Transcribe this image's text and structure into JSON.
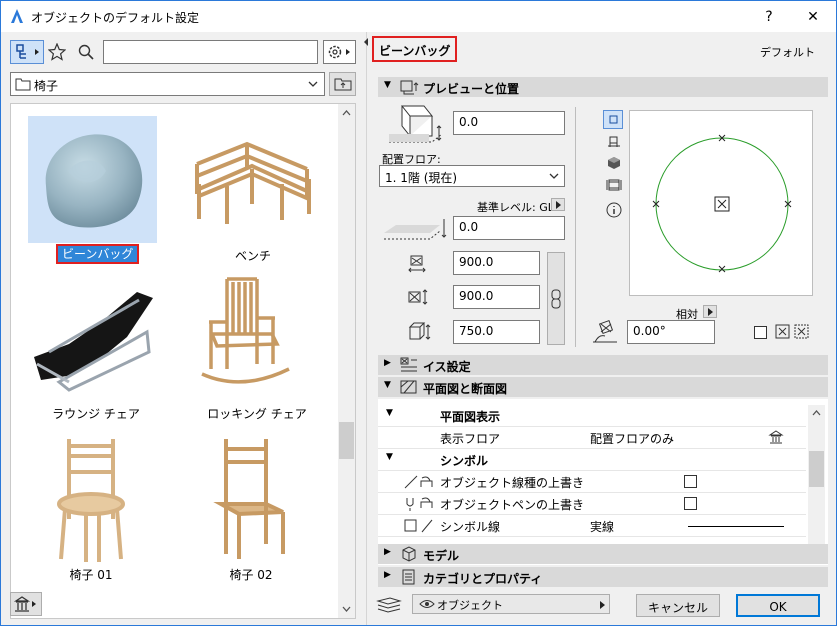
{
  "window": {
    "title": "オブジェクトのデフォルト設定",
    "help": "?",
    "close": "✕"
  },
  "library": {
    "search_placeholder": "",
    "folder": "椅子",
    "items": [
      {
        "label": "ビーンバッグ",
        "selected": true
      },
      {
        "label": "ベンチ"
      },
      {
        "label": "ラウンジ チェア"
      },
      {
        "label": "ロッキング チェア"
      },
      {
        "label": "椅子 01"
      },
      {
        "label": "椅子 02"
      }
    ]
  },
  "header": {
    "object_name": "ビーンバッグ",
    "default_label": "デフォルト"
  },
  "preview": {
    "section_title": "プレビューと位置",
    "elevation_value": "0.0",
    "floor_label": "配置フロア:",
    "floor_value": "1. 1階 (現在)",
    "ref_level_label": "基準レベル: GL",
    "ref_value": "0.0",
    "width": "900.0",
    "depth": "900.0",
    "height": "750.0",
    "relative_label": "相対",
    "angle": "0.00°"
  },
  "sections": {
    "chair_settings": "イス設定",
    "plan_section": "平面図と断面図",
    "model": "モデル",
    "category": "カテゴリとプロパティ"
  },
  "plan_table": {
    "group1": "平面図表示",
    "row1_label": "表示フロア",
    "row1_value": "配置フロアのみ",
    "group2": "シンボル",
    "row2_label": "オブジェクト線種の上書き",
    "row3_label": "オブジェクトペンの上書き",
    "row4_label": "シンボル線",
    "row4_value": "実線"
  },
  "footer": {
    "layer": "オブジェクト",
    "cancel": "キャンセル",
    "ok": "OK"
  },
  "colors": {
    "selection": "#2f86d8",
    "highlight_border": "#e02020",
    "circle": "#2a9d2a"
  }
}
